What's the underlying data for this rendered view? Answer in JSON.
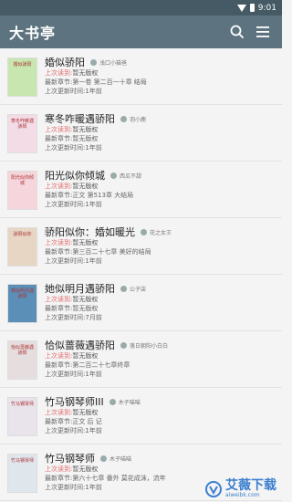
{
  "status": {
    "time": "9:01"
  },
  "appbar": {
    "title": "大书亭"
  },
  "books": [
    {
      "title": "婚似骄阳",
      "author": "浅口小猫爸",
      "read_label": "上次读到:",
      "read_value": "暂无版权",
      "latest_label": "最新章节:",
      "latest_value": "第一卷 第二百一十章 结局",
      "update_label": "上次更新时间:",
      "update_value": "1年前",
      "cover_color": "#c8e6b0",
      "cover_text": "婚似骄阳"
    },
    {
      "title": "寒冬咋暖遇骄阳",
      "author": "羽小鹿",
      "read_label": "上次读到:",
      "read_value": "暂无版权",
      "latest_label": "最新章节:",
      "latest_value": "暂无版权",
      "update_label": "上次更新时间:",
      "update_value": "1年前",
      "cover_color": "#f3dce6",
      "cover_text": "寒冬咋暖遇骄阳"
    },
    {
      "title": "阳光似你倾城",
      "author": "西瓜不甜",
      "read_label": "上次读到:",
      "read_value": "暂无版权",
      "latest_label": "最新章节:",
      "latest_value": "正文 第513章 大结局",
      "update_label": "上次更新时间:",
      "update_value": "1年前",
      "cover_color": "#f6d5dc",
      "cover_text": "阳光似你倾城"
    },
    {
      "title": "骄阳似你：婚如暖光",
      "author": "花之女王",
      "read_label": "上次读到:",
      "read_value": "暂无版权",
      "latest_label": "最新章节:",
      "latest_value": "第三百二十七章 美好的结局",
      "update_label": "上次更新时间:",
      "update_value": "1年前",
      "cover_color": "#e8d6c4",
      "cover_text": "骄阳似你"
    },
    {
      "title": "她似明月遇骄阳",
      "author": "公子柒",
      "read_label": "上次读到:",
      "read_value": "暂无版权",
      "latest_label": "最新章节:",
      "latest_value": "暂无版权",
      "update_label": "上次更新时间:",
      "update_value": "7月前",
      "cover_color": "#5b8fb8",
      "cover_text": "她似明月遇骄阳"
    },
    {
      "title": "恰似蔷薇遇骄阳",
      "author": "落日朝阳小白白",
      "read_label": "上次读到:",
      "read_value": "暂无版权",
      "latest_label": "最新章节:",
      "latest_value": "第二百二十七章终章",
      "update_label": "上次更新时间:",
      "update_value": "1年前",
      "cover_color": "#e6dede",
      "cover_text": "恰似蔷薇遇骄阳"
    },
    {
      "title": "竹马钢琴师III",
      "author": "木子喵喵",
      "read_label": "上次读到:",
      "read_value": "暂无版权",
      "latest_label": "最新章节:",
      "latest_value": "正文 后 记",
      "update_label": "上次更新时间:",
      "update_value": "1年前",
      "cover_color": "#e9e3ec",
      "cover_text": "竹马钢琴师"
    },
    {
      "title": "竹马钢琴师",
      "author": "木子喵喵",
      "read_label": "上次读到:",
      "read_value": "暂无版权",
      "latest_label": "最新章节:",
      "latest_value": "第六十七章 番外 莫花成沫，流年",
      "update_label": "上次更新时间:",
      "update_value": "1年前",
      "cover_color": "#dfe6ec",
      "cover_text": "竹马钢琴师"
    }
  ],
  "watermark": {
    "text": "艾薇下载",
    "url": "aiweibk.com"
  }
}
